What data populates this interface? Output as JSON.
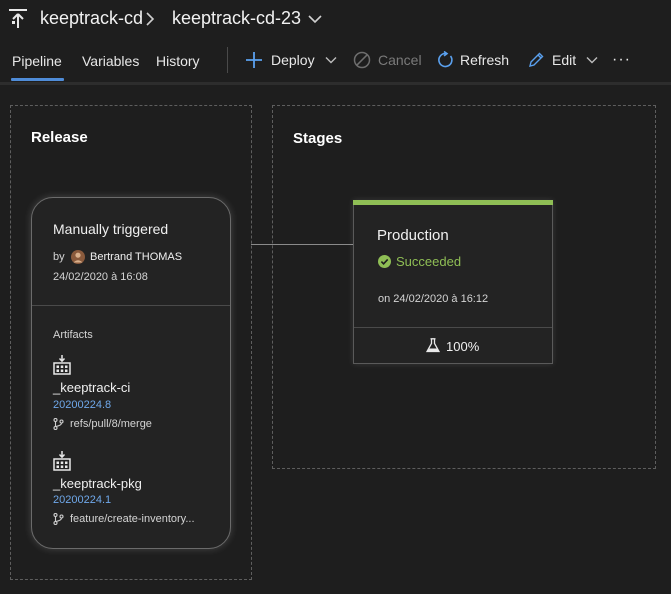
{
  "header": {
    "project": "keeptrack-cd",
    "release": "keeptrack-cd-23"
  },
  "tabs": [
    {
      "label": "Pipeline",
      "active": true
    },
    {
      "label": "Variables",
      "active": false
    },
    {
      "label": "History",
      "active": false
    }
  ],
  "toolbar": {
    "deploy": "Deploy",
    "cancel": "Cancel",
    "refresh": "Refresh",
    "edit": "Edit",
    "more": "···"
  },
  "release": {
    "title": "Release",
    "trigger": "Manually triggered",
    "by_label": "by",
    "user": "Bertrand THOMAS",
    "date": "24/02/2020 à 16:08",
    "artifacts_label": "Artifacts",
    "artifacts": [
      {
        "name": "_keeptrack-ci",
        "version": "20200224.8",
        "branch": "refs/pull/8/merge"
      },
      {
        "name": "_keeptrack-pkg",
        "version": "20200224.1",
        "branch": "feature/create-inventory..."
      }
    ]
  },
  "stages": {
    "title": "Stages",
    "items": [
      {
        "name": "Production",
        "status": "Succeeded",
        "date": "on 24/02/2020 à 16:12",
        "tests": "100%"
      }
    ]
  },
  "colors": {
    "background": "#1e1e1e",
    "accent": "#4f8cd8",
    "success": "#8fbe55",
    "link": "#6fa8ea"
  },
  "icons": {
    "pipeline": "release-pipeline-icon",
    "breadcrumb": "chevron-right-icon",
    "dropdown": "chevron-down-icon",
    "deploy": "plus-icon",
    "cancel": "cancel-circle-icon",
    "refresh": "refresh-icon",
    "edit": "pencil-icon",
    "artifact": "build-artifact-icon",
    "branch": "branch-icon",
    "status": "check-circle-icon",
    "tests": "flask-icon"
  }
}
